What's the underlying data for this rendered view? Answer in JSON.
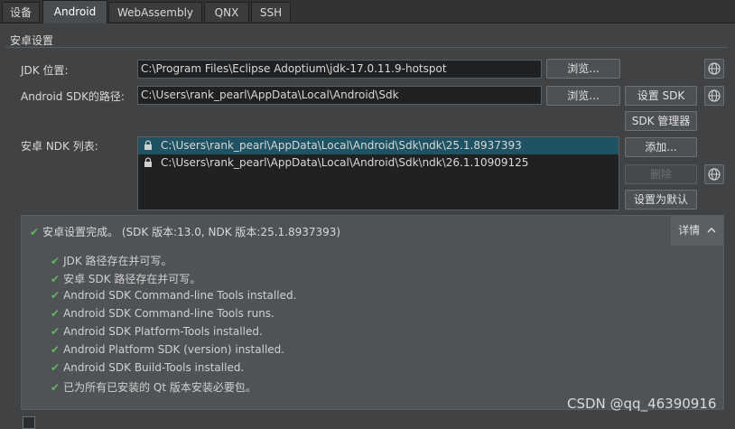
{
  "tabs": [
    {
      "label": "设备"
    },
    {
      "label": "Android"
    },
    {
      "label": "WebAssembly"
    },
    {
      "label": "QNX"
    },
    {
      "label": "SSH"
    }
  ],
  "section_title": "安卓设置",
  "jdk": {
    "label": "JDK 位置:",
    "value": "C:\\Program Files\\Eclipse Adoptium\\jdk-17.0.11.9-hotspot",
    "browse": "浏览..."
  },
  "sdk": {
    "label": "Android SDK的路径:",
    "value": "C:\\Users\\rank_pearl\\AppData\\Local\\Android\\Sdk",
    "browse": "浏览...",
    "setup": "设置 SDK",
    "manager": "SDK 管理器"
  },
  "ndk": {
    "label": "安卓 NDK 列表:",
    "items": [
      "C:\\Users\\rank_pearl\\AppData\\Local\\Android\\Sdk\\ndk\\25.1.8937393",
      "C:\\Users\\rank_pearl\\AppData\\Local\\Android\\Sdk\\ndk\\26.1.10909125"
    ],
    "add": "添加...",
    "remove": "删除",
    "set_default": "设置为默认"
  },
  "summary": {
    "status": "安卓设置完成。 (SDK 版本:13.0, NDK 版本:25.1.8937393)",
    "details": "详情",
    "checks": [
      "JDK 路径存在并可写。",
      "安卓 SDK 路径存在并可写。",
      "Android SDK Command-line Tools installed.",
      "Android SDK Command-line Tools runs.",
      "Android SDK Platform-Tools installed.",
      "Android Platform SDK (version) installed.",
      "Android SDK Build-Tools installed.",
      "已为所有已安装的 Qt 版本安装必要包。"
    ]
  },
  "watermark": "CSDN @qq_46390916",
  "colors": {
    "check": "#5cb85c",
    "selected_row": "#1f5262"
  }
}
